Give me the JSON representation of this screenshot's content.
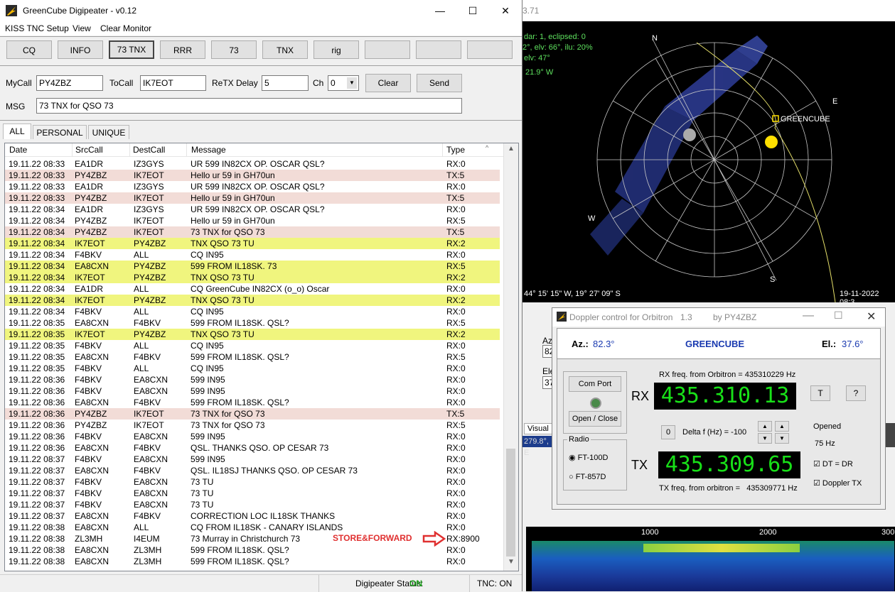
{
  "main_window": {
    "title": "GreenCube Digipeater - v0.12",
    "menu": [
      "KISS TNC Setup",
      "View",
      "Clear Monitor"
    ],
    "quick_buttons": [
      "CQ",
      "INFO",
      "73 TNX",
      "RRR",
      "73",
      "TNX",
      "rig",
      "",
      "",
      ""
    ],
    "form": {
      "mycall_label": "MyCall",
      "mycall_value": "PY4ZBZ",
      "tocall_label": "ToCall",
      "tocall_value": "IK7EOT",
      "retx_label": "ReTX Delay",
      "retx_value": "5",
      "ch_label": "Ch",
      "ch_value": "0",
      "clear_label": "Clear",
      "send_label": "Send",
      "msg_label": "MSG",
      "msg_value": "73  TNX for QSO  73"
    },
    "tabs": [
      "ALL",
      "PERSONAL",
      "UNIQUE"
    ],
    "columns": [
      "Date",
      "SrcCall",
      "DestCall",
      "Message",
      "Type"
    ],
    "rows": [
      [
        "19.11.22 08:33",
        "EA1DR",
        "IZ3GYS",
        "UR 599 IN82CX   OP. OSCAR QSL?",
        "RX:0",
        ""
      ],
      [
        "19.11.22 08:33",
        "PY4ZBZ",
        "IK7EOT",
        "Hello ur 59 in GH70un",
        "TX:5",
        "tx"
      ],
      [
        "19.11.22 08:33",
        "EA1DR",
        "IZ3GYS",
        "UR 599 IN82CX   OP. OSCAR QSL?",
        "RX:0",
        ""
      ],
      [
        "19.11.22 08:33",
        "PY4ZBZ",
        "IK7EOT",
        "Hello ur 59 in GH70un",
        "TX:5",
        "tx"
      ],
      [
        "19.11.22 08:34",
        "EA1DR",
        "IZ3GYS",
        "UR 599 IN82CX   OP. OSCAR QSL?",
        "RX:0",
        ""
      ],
      [
        "19.11.22 08:34",
        "PY4ZBZ",
        "IK7EOT",
        "Hello ur 59 in GH70un",
        "RX:5",
        ""
      ],
      [
        "19.11.22 08:34",
        "PY4ZBZ",
        "IK7EOT",
        "73  TNX for QSO  73",
        "TX:5",
        "tx"
      ],
      [
        "19.11.22 08:34",
        "IK7EOT",
        "PY4ZBZ",
        "TNX QSO 73 TU",
        "RX:2",
        "hl"
      ],
      [
        "19.11.22 08:34",
        "F4BKV",
        "ALL",
        "CQ IN95",
        "RX:0",
        ""
      ],
      [
        "19.11.22 08:34",
        "EA8CXN",
        "PY4ZBZ",
        "599 FROM IL18SK. 73",
        "RX:5",
        "hl"
      ],
      [
        "19.11.22 08:34",
        "IK7EOT",
        "PY4ZBZ",
        "TNX QSO 73 TU",
        "RX:2",
        "hl"
      ],
      [
        "19.11.22 08:34",
        "EA1DR",
        "ALL",
        "CQ GreenCube IN82CX (o_o) Oscar",
        "RX:0",
        ""
      ],
      [
        "19.11.22 08:34",
        "IK7EOT",
        "PY4ZBZ",
        "TNX QSO 73 TU",
        "RX:2",
        "hl"
      ],
      [
        "19.11.22 08:34",
        "F4BKV",
        "ALL",
        "CQ IN95",
        "RX:0",
        ""
      ],
      [
        "19.11.22 08:35",
        "EA8CXN",
        "F4BKV",
        "599 FROM IL18SK. QSL?",
        "RX:5",
        ""
      ],
      [
        "19.11.22 08:35",
        "IK7EOT",
        "PY4ZBZ",
        "TNX QSO 73 TU",
        "RX:2",
        "hl"
      ],
      [
        "19.11.22 08:35",
        "F4BKV",
        "ALL",
        "CQ IN95",
        "RX:0",
        ""
      ],
      [
        "19.11.22 08:35",
        "EA8CXN",
        "F4BKV",
        "599 FROM IL18SK. QSL?",
        "RX:5",
        ""
      ],
      [
        "19.11.22 08:35",
        "F4BKV",
        "ALL",
        "CQ IN95",
        "RX:0",
        ""
      ],
      [
        "19.11.22 08:36",
        "F4BKV",
        "EA8CXN",
        "599 IN95",
        "RX:0",
        ""
      ],
      [
        "19.11.22 08:36",
        "F4BKV",
        "EA8CXN",
        "599 IN95",
        "RX:0",
        ""
      ],
      [
        "19.11.22 08:36",
        "EA8CXN",
        "F4BKV",
        "599 FROM IL18SK. QSL?",
        "RX:0",
        ""
      ],
      [
        "19.11.22 08:36",
        "PY4ZBZ",
        "IK7EOT",
        "73  TNX for QSO  73",
        "TX:5",
        "tx"
      ],
      [
        "19.11.22 08:36",
        "PY4ZBZ",
        "IK7EOT",
        "73  TNX for QSO  73",
        "RX:5",
        ""
      ],
      [
        "19.11.22 08:36",
        "F4BKV",
        "EA8CXN",
        "599 IN95",
        "RX:0",
        ""
      ],
      [
        "19.11.22 08:36",
        "EA8CXN",
        "F4BKV",
        "QSL. THANKS QSO. OP CESAR 73",
        "RX:0",
        ""
      ],
      [
        "19.11.22 08:37",
        "F4BKV",
        "EA8CXN",
        "599 IN95",
        "RX:0",
        ""
      ],
      [
        "19.11.22 08:37",
        "EA8CXN",
        "F4BKV",
        "QSL. IL18SJ THANKS QSO. OP CESAR 73",
        "RX:0",
        ""
      ],
      [
        "19.11.22 08:37",
        "F4BKV",
        "EA8CXN",
        "73 TU",
        "RX:0",
        ""
      ],
      [
        "19.11.22 08:37",
        "F4BKV",
        "EA8CXN",
        "73 TU",
        "RX:0",
        ""
      ],
      [
        "19.11.22 08:37",
        "F4BKV",
        "EA8CXN",
        "73 TU",
        "RX:0",
        ""
      ],
      [
        "19.11.22 08:37",
        "EA8CXN",
        "F4BKV",
        "CORRECTION LOC IL18SK THANKS",
        "RX:0",
        ""
      ],
      [
        "19.11.22 08:38",
        "EA8CXN",
        "ALL",
        "CQ FROM IL18SK - CANARY ISLANDS",
        "RX:0",
        ""
      ],
      [
        "19.11.22 08:38",
        "ZL3MH",
        "I4EUM",
        "73 Murray in Christchurch 73",
        "RX:8900",
        ""
      ],
      [
        "19.11.22 08:38",
        "EA8CXN",
        "ZL3MH",
        "599 FROM IL18SK. QSL?",
        "RX:0",
        ""
      ],
      [
        "19.11.22 08:38",
        "EA8CXN",
        "ZL3MH",
        "599 FROM IL18SK. QSL?",
        "RX:0",
        ""
      ]
    ],
    "annotation": "STORE&FORWARD",
    "status": {
      "digi_label": "Digipeater Status:",
      "digi_value": "ON",
      "tnc": "TNC: ON"
    },
    "colors": {
      "tx_row": "#f2dcd7",
      "highlight_row": "#f0f57e",
      "status_on": "#1a9e1a",
      "annotation": "#e03030"
    }
  },
  "orbitron": {
    "ghost_title": "3.71",
    "info": [
      "dar: 1, eclipsed: 0",
      "2°, elv: 66°, ilu: 20%",
      "elv: 47°",
      "21.9° W"
    ],
    "compass": [
      "N",
      "E",
      "S",
      "W"
    ],
    "satellite": "GREENCUBE",
    "coords": "44° 15' 15\" W, 19° 27' 09\" S",
    "datetime": "19-11-2022 08:3",
    "side_labels": [
      "Az",
      "82",
      "Ele",
      "37"
    ],
    "visual_tab": "Visual",
    "partial_text": "279.8°, E",
    "freq_ticks": [
      "1000",
      "2000",
      "300"
    ]
  },
  "doppler": {
    "title": "Doppler control for Orbitron",
    "version": "1.3",
    "by": "by   PY4ZBZ",
    "az_label": "Az.:",
    "az_value": "82.3°",
    "sat_name": "GREENCUBE",
    "el_label": "El.:",
    "el_value": "37.6°",
    "com_port": "Com Port",
    "open_close": "Open / Close",
    "rx_label": "RX",
    "tx_label": "TX",
    "rx_freq_label": "RX freq. from Orbitron = ",
    "rx_freq_value": "435310229 Hz",
    "rx_display": "435.310.13",
    "tx_freq_label": "TX freq. from orbitron =",
    "tx_freq_value": "435309771 Hz",
    "tx_display": "435.309.65",
    "t_button": "T",
    "q_button": "?",
    "zero_button": "0",
    "delta_label": "Delta f (Hz) = -100",
    "radio_group": "Radio",
    "radio_options": [
      "FT-100D",
      "FT-857D"
    ],
    "opened": "Opened",
    "step": "75 Hz",
    "dt_dr": "DT = DR",
    "doppler_tx": "Doppler TX",
    "colors": {
      "lcd_bg": "#000000",
      "lcd_text": "#18e018",
      "sat_name": "#1a3ab0"
    }
  }
}
